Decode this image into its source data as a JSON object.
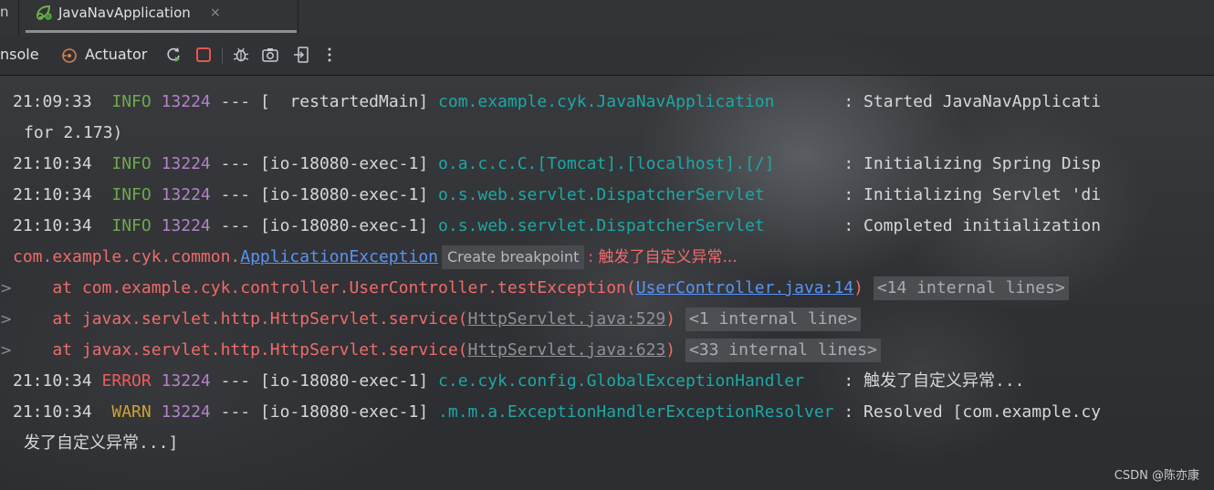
{
  "tabs": {
    "stub": "n",
    "active_label": "JavaNavApplication",
    "close": "×"
  },
  "toolbar": {
    "console_label": "nsole",
    "actuator_label": "Actuator",
    "icons": [
      "rerun-icon",
      "stop-icon",
      "debug-icon",
      "camera-icon",
      "exit-icon",
      "more-icon"
    ]
  },
  "log": {
    "l1": {
      "time": "21:09:33  ",
      "level": "INFO",
      "pid": "13224",
      "sep": " --- [  restartedMain] ",
      "logger": "com.example.cyk.JavaNavApplication",
      "msg": "       : Started JavaNavApplicati"
    },
    "l1b": {
      "text": "for 2.173)"
    },
    "l2": {
      "time": "21:10:34  ",
      "level": "INFO",
      "pid": "13224",
      "sep": " --- [io-18080-exec-1] ",
      "logger": "o.a.c.c.C.[Tomcat].[localhost].[/]",
      "msg": "       : Initializing Spring Disp"
    },
    "l3": {
      "time": "21:10:34  ",
      "level": "INFO",
      "pid": "13224",
      "sep": " --- [io-18080-exec-1] ",
      "logger": "o.s.web.servlet.DispatcherServlet",
      "msg": "        : Initializing Servlet 'di"
    },
    "l4": {
      "time": "21:10:34  ",
      "level": "INFO",
      "pid": "13224",
      "sep": " --- [io-18080-exec-1] ",
      "logger": "o.s.web.servlet.DispatcherServlet",
      "msg": "        : Completed initialization"
    },
    "exc": {
      "prefix": "com.example.cyk.common.",
      "cls": "ApplicationException",
      "breakpoint": "Create breakpoint",
      "msg": ": 触发了自定义异常..."
    },
    "st1": {
      "at": "    at com.example.cyk.controller.UserController.testException(",
      "link": "UserController.java:14",
      "close": ")",
      "chip": "<14 internal lines>"
    },
    "st2": {
      "at": "    at javax.servlet.http.HttpServlet.service(",
      "link": "HttpServlet.java:529",
      "close": ")",
      "chip": "<1 internal line>"
    },
    "st3": {
      "at": "    at javax.servlet.http.HttpServlet.service(",
      "link": "HttpServlet.java:623",
      "close": ")",
      "chip": "<33 internal lines>"
    },
    "l5": {
      "time": "21:10:34 ",
      "level": "ERROR",
      "pid": "13224",
      "sep": " --- [io-18080-exec-1] ",
      "logger": "c.e.cyk.config.GlobalExceptionHandler",
      "msg": "    : 触发了自定义异常..."
    },
    "l6": {
      "time": "21:10:34  ",
      "level": "WARN",
      "pid": "13224",
      "sep": " --- [io-18080-exec-1] ",
      "logger": ".m.m.a.ExceptionHandlerExceptionResolver",
      "msg": " : Resolved [com.example.cy"
    },
    "l6b": {
      "text": "发了自定义异常...]"
    }
  },
  "fold_glyph": ">",
  "watermark": "CSDN @陈亦康",
  "colors": {
    "info": "#6fa84d",
    "error": "#ef5a5a",
    "warn": "#cfa233",
    "logger": "#1ca8a6",
    "link": "#5b93f5"
  }
}
